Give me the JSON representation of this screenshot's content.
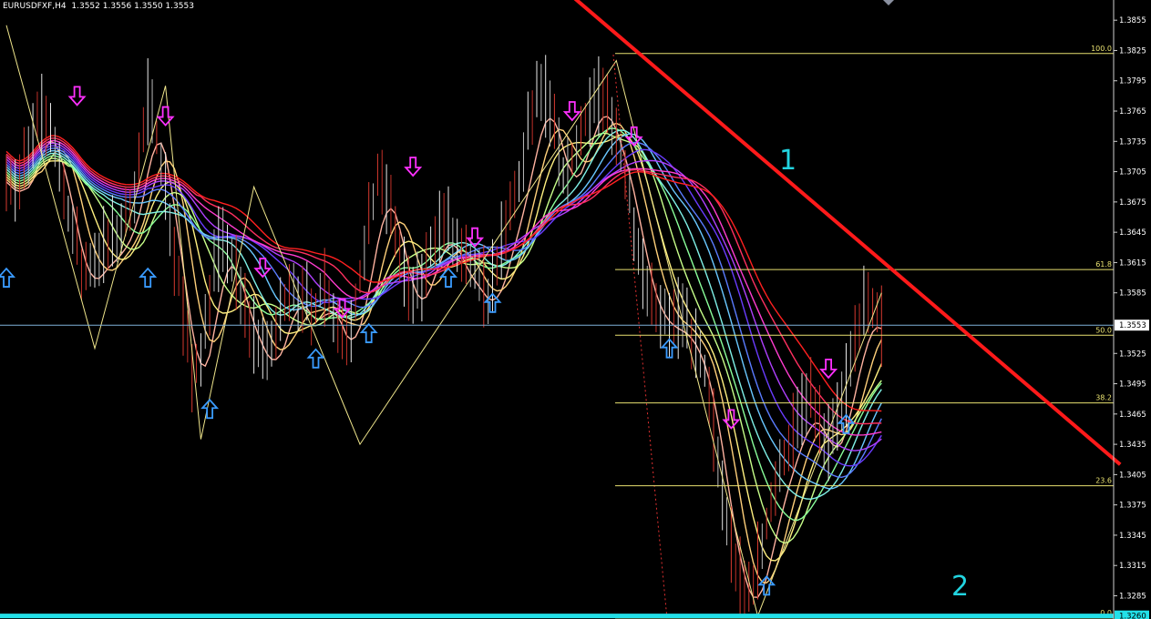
{
  "chart_data": {
    "type": "candlestick",
    "header": {
      "symbol": "EURUSDFXF,H4",
      "ohlc": "1.3552 1.3556 1.3550 1.3553"
    },
    "ylim": [
      1.3262,
      1.3875
    ],
    "y_ticks": [
      "1.3855",
      "1.3825",
      "1.3795",
      "1.3765",
      "1.3735",
      "1.3705",
      "1.3675",
      "1.3645",
      "1.3615",
      "1.3585",
      "1.3525",
      "1.3495",
      "1.3465",
      "1.3435",
      "1.3405",
      "1.3375",
      "1.3345",
      "1.3315",
      "1.3285"
    ],
    "current_price_label": "1.3553",
    "current_price": 1.3553,
    "bottom_price_label": "1.3260",
    "bottom_price": 1.3265,
    "fibonacci": [
      {
        "label": "100.0",
        "price": 1.3822
      },
      {
        "label": "61.8",
        "price": 1.3608
      },
      {
        "label": "50.0",
        "price": 1.3543
      },
      {
        "label": "38.2",
        "price": 1.3476
      },
      {
        "label": "23.6",
        "price": 1.3394
      },
      {
        "label": "0.0",
        "price": 1.3263
      }
    ],
    "annotations": [
      {
        "text": "1",
        "color": "#22d4e0"
      },
      {
        "text": "2",
        "color": "#22d4e0"
      }
    ],
    "price_path": [
      [
        0,
        1.371
      ],
      [
        1,
        1.369
      ],
      [
        2,
        1.372
      ],
      [
        3,
        1.376
      ],
      [
        4,
        1.375
      ],
      [
        5,
        1.37
      ],
      [
        6,
        1.365
      ],
      [
        7,
        1.36
      ],
      [
        8,
        1.362
      ],
      [
        9,
        1.363
      ],
      [
        10,
        1.364
      ],
      [
        11,
        1.366
      ],
      [
        12,
        1.37
      ],
      [
        13,
        1.378
      ],
      [
        14,
        1.373
      ],
      [
        15,
        1.365
      ],
      [
        16,
        1.358
      ],
      [
        17,
        1.35
      ],
      [
        18,
        1.354
      ],
      [
        19,
        1.362
      ],
      [
        20,
        1.364
      ],
      [
        21,
        1.36
      ],
      [
        22,
        1.356
      ],
      [
        23,
        1.354
      ],
      [
        24,
        1.352
      ],
      [
        25,
        1.356
      ],
      [
        26,
        1.36
      ],
      [
        27,
        1.358
      ],
      [
        28,
        1.356
      ],
      [
        29,
        1.36
      ],
      [
        30,
        1.356
      ],
      [
        31,
        1.354
      ],
      [
        32,
        1.358
      ],
      [
        33,
        1.364
      ],
      [
        34,
        1.37
      ],
      [
        35,
        1.368
      ],
      [
        36,
        1.362
      ],
      [
        37,
        1.358
      ],
      [
        38,
        1.36
      ],
      [
        39,
        1.364
      ],
      [
        40,
        1.366
      ],
      [
        41,
        1.363
      ],
      [
        42,
        1.361
      ],
      [
        43,
        1.36
      ],
      [
        44,
        1.358
      ],
      [
        45,
        1.362
      ],
      [
        46,
        1.366
      ],
      [
        47,
        1.37
      ],
      [
        48,
        1.376
      ],
      [
        49,
        1.379
      ],
      [
        50,
        1.375
      ],
      [
        51,
        1.37
      ],
      [
        52,
        1.372
      ],
      [
        53,
        1.376
      ],
      [
        54,
        1.379
      ],
      [
        55,
        1.376
      ],
      [
        56,
        1.373
      ],
      [
        57,
        1.368
      ],
      [
        58,
        1.362
      ],
      [
        59,
        1.358
      ],
      [
        60,
        1.357
      ],
      [
        61,
        1.356
      ],
      [
        62,
        1.356
      ],
      [
        63,
        1.353
      ],
      [
        64,
        1.35
      ],
      [
        65,
        1.342
      ],
      [
        66,
        1.335
      ],
      [
        67,
        1.33
      ],
      [
        68,
        1.3285
      ],
      [
        69,
        1.333
      ],
      [
        70,
        1.338
      ],
      [
        71,
        1.342
      ],
      [
        72,
        1.345
      ],
      [
        73,
        1.348
      ],
      [
        74,
        1.347
      ],
      [
        75,
        1.343
      ],
      [
        76,
        1.346
      ],
      [
        77,
        1.351
      ],
      [
        78,
        1.356
      ],
      [
        79,
        1.3575
      ],
      [
        80,
        1.3553
      ]
    ],
    "arrows_up": [
      [
        0,
        1.36
      ],
      [
        16,
        1.36
      ],
      [
        23,
        1.347
      ],
      [
        35,
        1.352
      ],
      [
        41,
        1.3545
      ],
      [
        50,
        1.36
      ],
      [
        55,
        1.3575
      ],
      [
        75,
        1.353
      ],
      [
        86,
        1.3295
      ],
      [
        95,
        1.3455
      ]
    ],
    "arrows_down": [
      [
        8,
        1.378
      ],
      [
        18,
        1.376
      ],
      [
        29,
        1.361
      ],
      [
        38,
        1.357
      ],
      [
        46,
        1.371
      ],
      [
        53,
        1.364
      ],
      [
        64,
        1.3765
      ],
      [
        71,
        1.374
      ],
      [
        82,
        1.346
      ],
      [
        93,
        1.351
      ]
    ],
    "zigzag": [
      [
        0,
        1.385
      ],
      [
        10,
        1.353
      ],
      [
        18,
        1.379
      ],
      [
        22,
        1.344
      ],
      [
        28,
        1.369
      ],
      [
        40,
        1.3435
      ],
      [
        69,
        1.3815
      ],
      [
        85,
        1.3265
      ],
      [
        99,
        1.3585
      ]
    ],
    "trendline": {
      "start": [
        62.5,
        1.389
      ],
      "end": [
        126,
        1.3415
      ],
      "color": "#ff1a1a"
    }
  }
}
